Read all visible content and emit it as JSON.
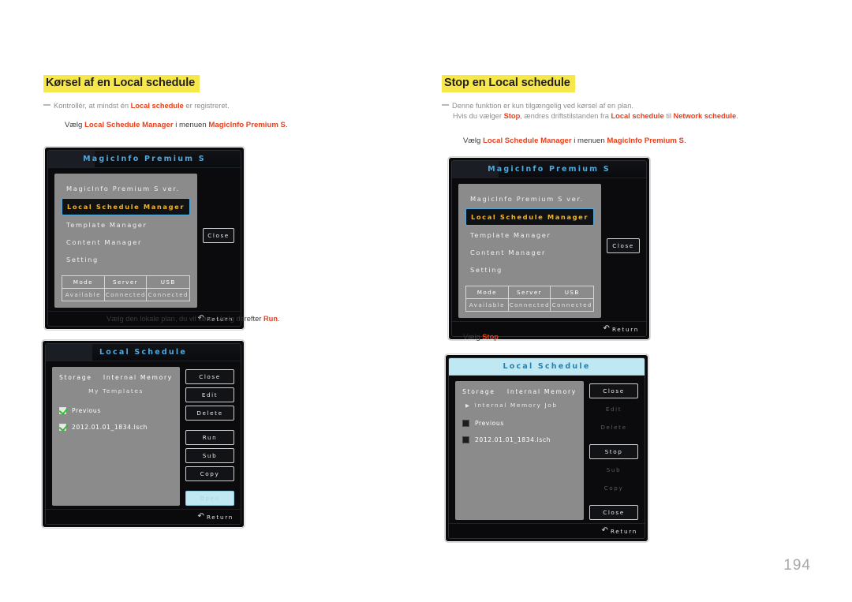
{
  "page": {
    "number": "194"
  },
  "left": {
    "heading": "Kørsel af en Local schedule",
    "note": {
      "pre": "Kontrollér, at mindst én ",
      "bold1": "Local schedule",
      "post": " er registreret."
    },
    "instruction": {
      "pre": "Vælg ",
      "bold1": "Local Schedule Manager",
      "mid": " i menuen ",
      "bold2": "MagicInfo Premium S",
      "post": "."
    },
    "caption": {
      "pre": "Vælg den lokale plan, du vil køre. Vælg derefter ",
      "bold1": "Run",
      "post": "."
    },
    "shot1": {
      "title": "MagicInfo Premium S",
      "menu": [
        "MagicInfo Premium S ver.",
        "Local Schedule Manager",
        "Template Manager",
        "Content Manager",
        "Setting"
      ],
      "status_headers": [
        "Mode",
        "Server",
        "USB"
      ],
      "status_values": [
        "Available",
        "Connected",
        "Connected"
      ],
      "close_label": "Close",
      "footer_label": "Return",
      "return_icon": "return-arrow-icon"
    },
    "shot2": {
      "title": "Local Schedule",
      "head_left": "Storage",
      "head_right": "Internal Memory",
      "sub": "My Templates",
      "items": [
        {
          "label": "Previous",
          "checked": true
        },
        {
          "label": "2012.01.01_1834.lsch",
          "checked": true
        }
      ],
      "buttons": [
        {
          "label": "Close",
          "state": "normal"
        },
        {
          "label": "Edit",
          "state": "normal"
        },
        {
          "label": "Delete",
          "state": "normal"
        },
        {
          "label": "Run",
          "state": "normal"
        },
        {
          "label": "Sub",
          "state": "normal"
        },
        {
          "label": "Copy",
          "state": "normal"
        },
        {
          "label": "Open",
          "state": "selected"
        }
      ],
      "footer_label": "Return",
      "return_icon": "return-arrow-icon"
    }
  },
  "right": {
    "heading": "Stop en Local schedule",
    "note": {
      "line1": "Denne funktion er kun tilgængelig ved kørsel af en plan.",
      "l2_pre": "Hvis du vælger ",
      "l2_b1": "Stop",
      "l2_mid": ", ændres driftstilstanden fra ",
      "l2_b2": "Local schedule",
      "l2_mid2": " til ",
      "l2_b3": "Network schedule",
      "l2_post": "."
    },
    "instruction": {
      "pre": "Vælg ",
      "bold1": "Local Schedule Manager",
      "mid": " i menuen ",
      "bold2": "MagicInfo Premium S",
      "post": "."
    },
    "caption": {
      "pre": "Vælg ",
      "bold1": "Stop",
      "post": "."
    },
    "shot1": {
      "title": "MagicInfo Premium S",
      "menu": [
        "MagicInfo Premium S ver.",
        "Local Schedule Manager",
        "Template Manager",
        "Content Manager",
        "Setting"
      ],
      "status_headers": [
        "Mode",
        "Server",
        "USB"
      ],
      "status_values": [
        "Available",
        "Connected",
        "Connected"
      ],
      "close_label": "Close",
      "footer_label": "Return",
      "return_icon": "return-arrow-icon"
    },
    "shot2": {
      "title": "Local Schedule",
      "head_left": "Storage",
      "head_right": "Internal Memory",
      "sub": "Internal Memory Job",
      "sub_arrow": "▶",
      "items": [
        {
          "label": "Previous",
          "checked": false
        },
        {
          "label": "2012.01.01_1834.lsch",
          "checked": false
        }
      ],
      "buttons": [
        {
          "label": "Close",
          "state": "normal"
        },
        {
          "label": "Edit",
          "state": "dim"
        },
        {
          "label": "Delete",
          "state": "dim"
        },
        {
          "label": "Stop",
          "state": "normal"
        },
        {
          "label": "Sub",
          "state": "dim"
        },
        {
          "label": "Copy",
          "state": "dim"
        },
        {
          "label": "Close",
          "state": "normal"
        }
      ],
      "footer_label": "Return",
      "return_icon": "return-arrow-icon"
    }
  }
}
